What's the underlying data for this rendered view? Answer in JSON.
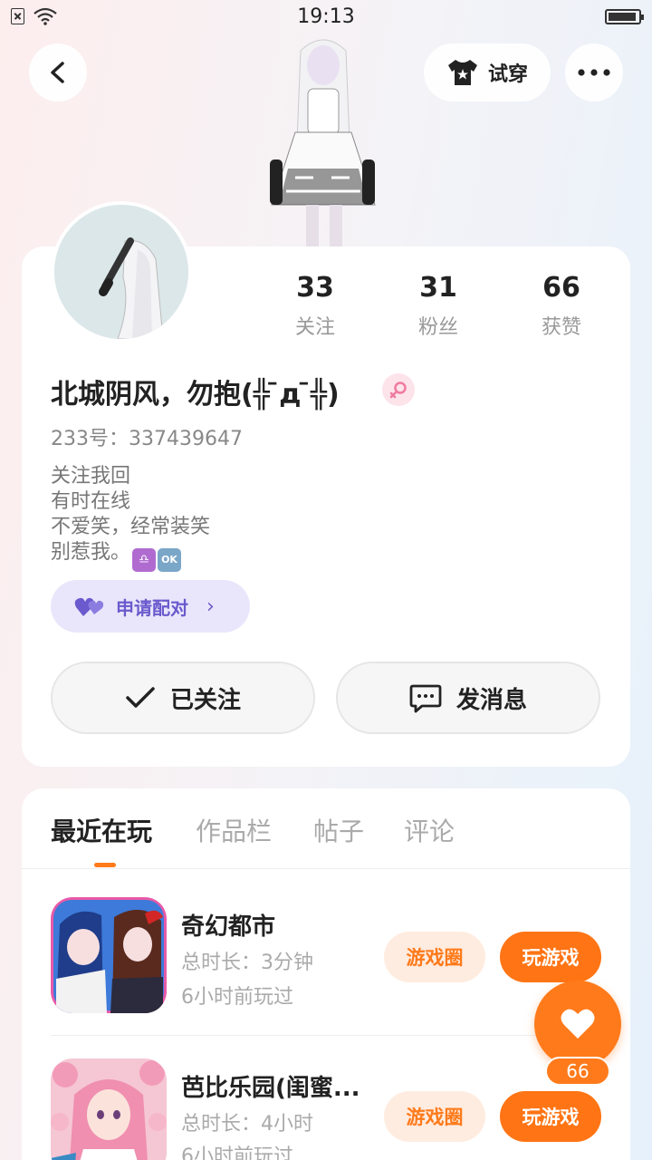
{
  "status_bar": {
    "time": "19:13"
  },
  "header": {
    "tryon_label": "试穿"
  },
  "profile": {
    "stats": [
      {
        "value": "33",
        "label": "关注"
      },
      {
        "value": "31",
        "label": "粉丝"
      },
      {
        "value": "66",
        "label": "获赞"
      }
    ],
    "nickname": "北城阴风，勿抱(╬ ̄д ̄╬)",
    "uid": "233号：337439647",
    "bio": [
      "关注我回",
      "有时在线",
      "不爱笑，经常装笑",
      "别惹我。"
    ],
    "bio_emoji": [
      "♎",
      "OK"
    ],
    "pair_label": "申请配对",
    "follow_label": "已关注",
    "message_label": "发消息"
  },
  "tabs": [
    "最近在玩",
    "作品栏",
    "帖子",
    "评论"
  ],
  "games": [
    {
      "title": "奇幻都市",
      "duration": "总时长：3分钟",
      "last_played": "6小时前玩过",
      "circle_label": "游戏圈",
      "play_label": "玩游戏"
    },
    {
      "title": "芭比乐园(闺蜜...",
      "duration": "总时长：4小时",
      "last_played": "6小时前玩过",
      "circle_label": "游戏圈",
      "play_label": "玩游戏"
    }
  ],
  "like_count": "66",
  "colors": {
    "accent": "#ff7a1a",
    "pair": "#6a5acd"
  }
}
